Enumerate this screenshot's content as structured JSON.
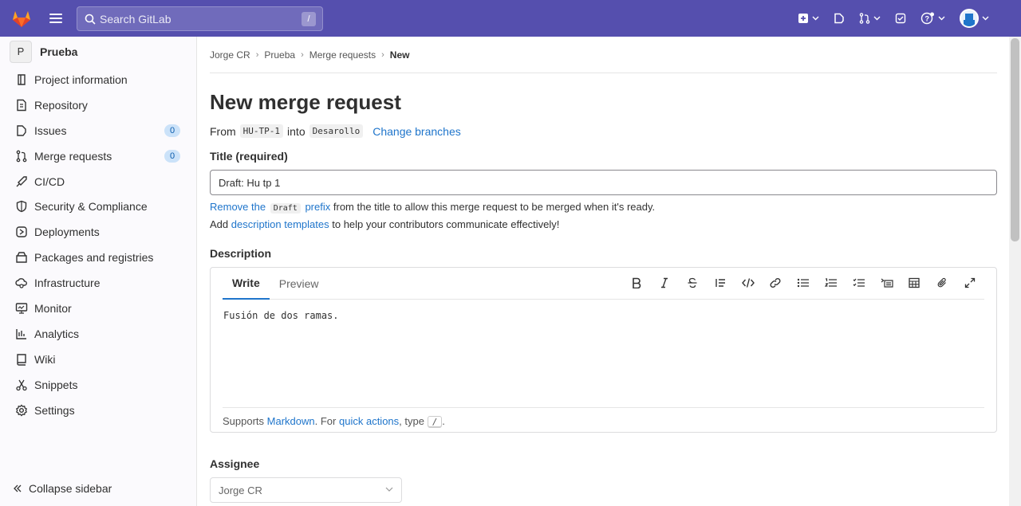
{
  "topbar": {
    "search_placeholder": "Search GitLab",
    "search_shortcut": "/",
    "icons": [
      "plus-square-icon",
      "issues-icon",
      "merge-request-icon",
      "todo-icon",
      "help-icon",
      "avatar"
    ]
  },
  "sidebar": {
    "project_initial": "P",
    "project_name": "Prueba",
    "items": [
      {
        "label": "Project information",
        "icon": "project-info-icon"
      },
      {
        "label": "Repository",
        "icon": "repository-icon"
      },
      {
        "label": "Issues",
        "icon": "issues-icon",
        "badge": "0"
      },
      {
        "label": "Merge requests",
        "icon": "merge-request-icon",
        "badge": "0"
      },
      {
        "label": "CI/CD",
        "icon": "rocket-icon"
      },
      {
        "label": "Security & Compliance",
        "icon": "shield-icon"
      },
      {
        "label": "Deployments",
        "icon": "deployments-icon"
      },
      {
        "label": "Packages and registries",
        "icon": "package-icon"
      },
      {
        "label": "Infrastructure",
        "icon": "cloud-gear-icon"
      },
      {
        "label": "Monitor",
        "icon": "monitor-icon"
      },
      {
        "label": "Analytics",
        "icon": "analytics-icon"
      },
      {
        "label": "Wiki",
        "icon": "book-icon"
      },
      {
        "label": "Snippets",
        "icon": "snippet-icon"
      },
      {
        "label": "Settings",
        "icon": "settings-icon"
      }
    ],
    "collapse_label": "Collapse sidebar"
  },
  "breadcrumb": [
    "Jorge CR",
    "Prueba",
    "Merge requests",
    "New"
  ],
  "page_title": "New merge request",
  "branches": {
    "from_label": "From",
    "source": "HU-TP-1",
    "into_label": "into",
    "target": "Desarollo",
    "change_link": "Change branches"
  },
  "title_field": {
    "label": "Title (required)",
    "value": "Draft: Hu tp 1"
  },
  "draft_hint": {
    "link1": "Remove the",
    "code": "Draft",
    "link2": "prefix",
    "rest": "from the title to allow this merge request to be merged when it's ready."
  },
  "template_hint": {
    "prefix": "Add",
    "link": "description templates",
    "rest": "to help your contributors communicate effectively!"
  },
  "description": {
    "label": "Description",
    "tab_write": "Write",
    "tab_preview": "Preview",
    "content": "Fusión de dos ramas.",
    "footer_prefix": "Supports",
    "footer_markdown": "Markdown",
    "footer_mid": ". For",
    "footer_quick": "quick actions",
    "footer_type": ", type",
    "footer_key": "/",
    "footer_end": "."
  },
  "assignee": {
    "label": "Assignee",
    "value": "Jorge CR"
  }
}
